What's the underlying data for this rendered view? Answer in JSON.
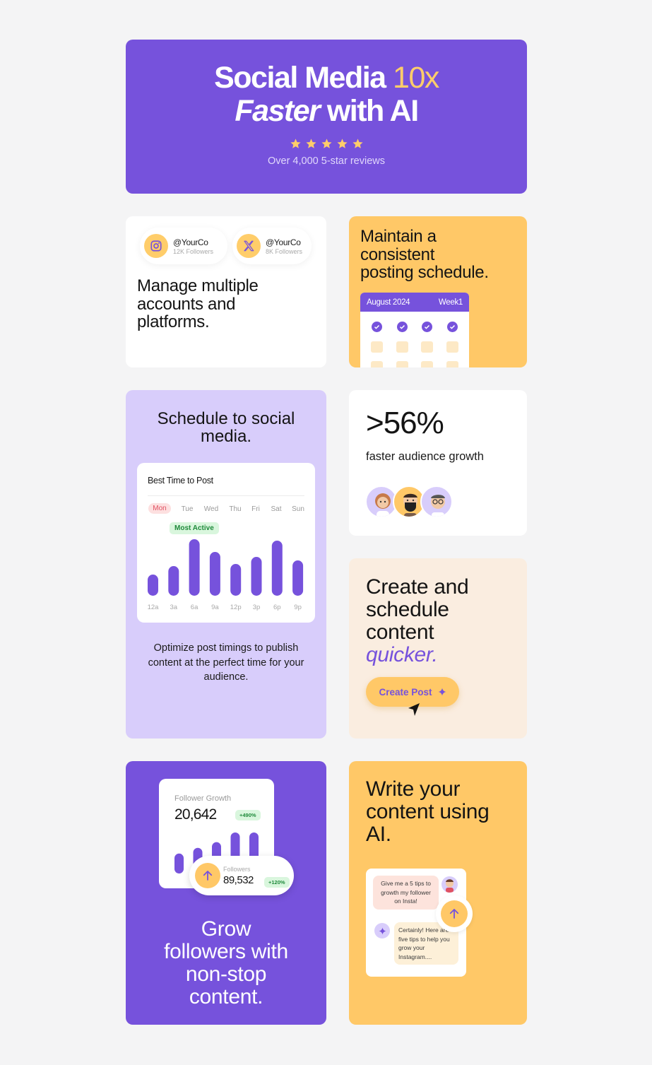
{
  "colors": {
    "brand_purple": "#7652dc",
    "accent_yellow": "#ffc867",
    "lavender": "#d8cdfb",
    "cream": "#faede0",
    "success_green": "#1f8a3b"
  },
  "hero": {
    "title_part1": "Social Media ",
    "title_accent": "10x",
    "title_italic": "Faster",
    "title_part2": " with AI",
    "stars": 5,
    "reviews_text": "Over 4,000 5-star reviews"
  },
  "accounts_card": {
    "accounts": [
      {
        "platform_icon": "instagram-icon",
        "handle": "@YourCo",
        "followers": "12K Followers"
      },
      {
        "platform_icon": "x-icon",
        "handle": "@YourCo",
        "followers": "8K Followers"
      }
    ],
    "heading_lines": [
      "Manage multiple",
      "accounts and",
      "platforms."
    ]
  },
  "schedule_card": {
    "heading_lines": [
      "Maintain a",
      "consistent",
      "posting schedule."
    ],
    "calendar_month": "August 2024",
    "calendar_week": "Week1"
  },
  "best_time_card": {
    "heading_lines": [
      "Schedule to social",
      "media."
    ],
    "panel_title": "Best Time to Post",
    "days": [
      "Mon",
      "Tue",
      "Wed",
      "Thu",
      "Fri",
      "Sat",
      "Sun"
    ],
    "active_day": "Mon",
    "most_active_label": "Most Active",
    "description": "Optimize post timings to publish content at the perfect time for your audience."
  },
  "chart_data": {
    "type": "bar",
    "title": "Best Time to Post",
    "categories": [
      "12a",
      "3a",
      "6a",
      "9a",
      "12p",
      "3p",
      "6p",
      "9p"
    ],
    "values": [
      30,
      42,
      80,
      62,
      45,
      55,
      78,
      50
    ],
    "highlight": "6a",
    "annotation": "Most Active",
    "ylim": [
      0,
      100
    ]
  },
  "stat_card": {
    "value": ">56%",
    "label": "faster audience growth",
    "avatars": [
      "avatar-woman",
      "avatar-man-mask",
      "avatar-man-glasses"
    ]
  },
  "create_card": {
    "heading_lines": [
      "Create and",
      "schedule",
      "content"
    ],
    "heading_italic": "quicker.",
    "button_label": "Create Post"
  },
  "grow_card": {
    "growth_label": "Follower Growth",
    "growth_value": "20,642",
    "growth_badge": "+490%",
    "growth_bars": [
      35,
      45,
      55,
      72,
      72
    ],
    "followers_label": "Followers",
    "followers_value": "89,532",
    "followers_badge": "+120%",
    "heading_lines": [
      "Grow",
      "followers with",
      "non-stop",
      "content."
    ]
  },
  "ai_card": {
    "heading_lines": [
      "Write your",
      "content using",
      "AI."
    ],
    "user_message": "Give me a 5 tips to growth my follower on Insta!",
    "bot_message": "Certainly! Here are five tips to help you grow your Instagram...."
  }
}
